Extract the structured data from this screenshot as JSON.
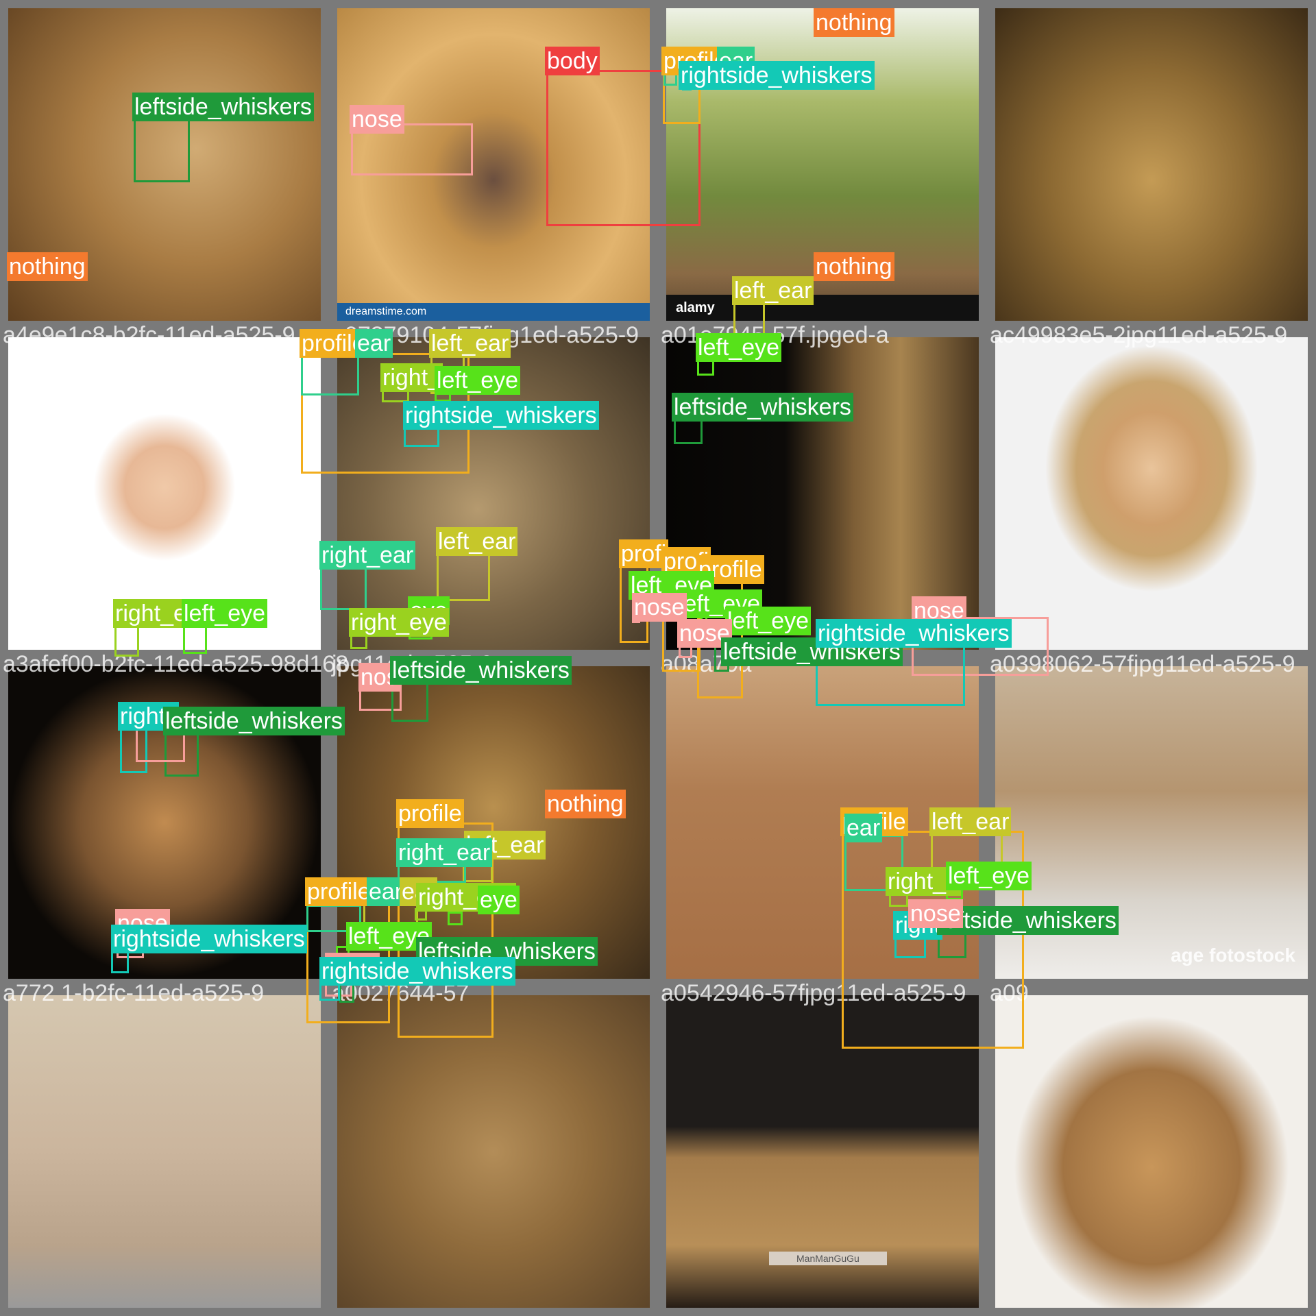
{
  "colors": {
    "nothing": "#f47a2e",
    "body": "#ef3f3f",
    "profile": "#f2ae1d",
    "nose": "#f79e9a",
    "left_ear": "#c6c72a",
    "right_ear": "#2fcf8c",
    "left_eye": "#57e21a",
    "right_eye": "#9ad21f",
    "leftside_whiskers": "#1f9a3a",
    "rightside_whiskers": "#13c9b6",
    "tile_border": "#7a7a7a"
  },
  "tiles": [
    {
      "filename": "",
      "photo": "lion-face-held-by-hand",
      "labels": [
        {
          "cls": "leftside_whiskers",
          "text": "leftside_whiskers"
        },
        {
          "cls": "nothing",
          "text": "nothing"
        }
      ]
    },
    {
      "filename": "",
      "photo": "lion-nose-closeup",
      "watermark": "dreamstime.com",
      "labels": [
        {
          "cls": "nose",
          "text": "nose"
        }
      ]
    },
    {
      "filename": "",
      "photo": "lioness-on-rock",
      "watermark": "alamy",
      "labels": [
        {
          "cls": "body",
          "text": "body"
        },
        {
          "cls": "profile",
          "text": "profile"
        },
        {
          "cls": "right_ear",
          "text": "ear"
        },
        {
          "cls": "rightside_whiskers",
          "text": "rightside_whiskers"
        }
      ]
    },
    {
      "filename": "",
      "photo": "lion-painting",
      "labels": [
        {
          "cls": "nothing",
          "text": "nothing"
        },
        {
          "cls": "nothing",
          "text": "nothing"
        }
      ]
    },
    {
      "filename": "a4e9e1c8-b2fc-11ed-a525-9",
      "photo": "man-with-lion-ears",
      "labels": []
    },
    {
      "filename": "a07379104-57fjpg1ed-a525-9",
      "photo": "lioness-snarling",
      "labels": [
        {
          "cls": "profile",
          "text": "profile"
        },
        {
          "cls": "right_ear",
          "text": "ear"
        },
        {
          "cls": "left_ear",
          "text": "left_ear"
        },
        {
          "cls": "right_eye",
          "text": "right_"
        },
        {
          "cls": "left_eye",
          "text": "left_eye"
        },
        {
          "cls": "rightside_whiskers",
          "text": "rightside_whiskers"
        }
      ]
    },
    {
      "filename": "a01e7945-57f.jpged-a",
      "photo": "male-lion-dark",
      "labels": [
        {
          "cls": "left_ear",
          "text": "left_ear"
        },
        {
          "cls": "left_eye",
          "text": "left_eye"
        },
        {
          "cls": "leftside_whiskers",
          "text": "leftside_whiskers"
        }
      ]
    },
    {
      "filename": "ac49983e5-2jpg11ed-a525-9",
      "photo": "woman-lion-mask",
      "labels": []
    },
    {
      "filename": "a3afef00-b2fc-11ed-a525-98d168",
      "photo": "lion-face-black-bg",
      "labels": [
        {
          "cls": "right_eye",
          "text": "right_e"
        },
        {
          "cls": "left_eye",
          "text": "left_eye"
        },
        {
          "cls": "rightside_whiskers",
          "text": "rights"
        },
        {
          "cls": "leftside_whiskers",
          "text": "leftside_whiskers"
        }
      ]
    },
    {
      "filename": "jpg11ed-a525-9",
      "photo": "lion-mane-closeup",
      "labels": [
        {
          "cls": "right_ear",
          "text": "right_ear"
        },
        {
          "cls": "left_ear",
          "text": "left_ear"
        },
        {
          "cls": "left_eye",
          "text": "eye"
        },
        {
          "cls": "right_eye",
          "text": "right_eye"
        },
        {
          "cls": "nose",
          "text": "nos"
        },
        {
          "cls": "leftside_whiskers",
          "text": "leftside_whiskers"
        }
      ]
    },
    {
      "filename": "a08a79a",
      "photo": "three-lions-walking",
      "labels": [
        {
          "cls": "profile",
          "text": "profi"
        },
        {
          "cls": "profile",
          "text": "profi"
        },
        {
          "cls": "profile",
          "text": "profile"
        },
        {
          "cls": "left_eye",
          "text": "left_eye"
        },
        {
          "cls": "left_eye",
          "text": "left_eye"
        },
        {
          "cls": "left_eye",
          "text": "left_eye"
        },
        {
          "cls": "nose",
          "text": "nose"
        },
        {
          "cls": "nose",
          "text": "nose"
        },
        {
          "cls": "leftside_whiskers",
          "text": "leftside_whiskers"
        }
      ]
    },
    {
      "filename": "a0398062-57fjpg11ed-a525-9",
      "photo": "lion-muzzle-closeup",
      "watermark": "age fotostock",
      "labels": [
        {
          "cls": "nose",
          "text": "nose"
        },
        {
          "cls": "rightside_whiskers",
          "text": "rightside_whiskers"
        }
      ]
    },
    {
      "filename": "a772 1-b2fc-11ed-a525-9",
      "photo": "lion-skin-on-sack",
      "labels": [
        {
          "cls": "nose",
          "text": "nose"
        },
        {
          "cls": "rightside_whiskers",
          "text": "rightside_whiskers"
        }
      ]
    },
    {
      "filename": "a0027644-57",
      "photo": "lion-pair",
      "labels": [
        {
          "cls": "profile",
          "text": "profile"
        },
        {
          "cls": "left_ear",
          "text": "left_ear"
        },
        {
          "cls": "right_ear",
          "text": "right_ear"
        },
        {
          "cls": "profile",
          "text": "profile"
        },
        {
          "cls": "right_ear",
          "text": "ear"
        },
        {
          "cls": "left_ear",
          "text": "ear"
        },
        {
          "cls": "right_eye",
          "text": "right_eye"
        },
        {
          "cls": "left_eye",
          "text": "eye"
        },
        {
          "cls": "left_eye",
          "text": "left_eye"
        },
        {
          "cls": "nose",
          "text": "nose"
        },
        {
          "cls": "leftside_whiskers",
          "text": "leftside_whiskers"
        },
        {
          "cls": "rightside_whiskers",
          "text": "rightside_whiskers"
        }
      ]
    },
    {
      "filename": "a0542946-57fjpg11ed-a525-9",
      "photo": "lion-head-back",
      "watermark": "ManManGuGu",
      "labels": [
        {
          "cls": "nothing",
          "text": "nothing"
        }
      ]
    },
    {
      "filename": "a09",
      "photo": "lion-head-cutout",
      "labels": [
        {
          "cls": "profile",
          "text": "profile"
        },
        {
          "cls": "right_ear",
          "text": "ear"
        },
        {
          "cls": "left_ear",
          "text": "left_ear"
        },
        {
          "cls": "right_eye",
          "text": "right_e"
        },
        {
          "cls": "left_eye",
          "text": "left_eye"
        },
        {
          "cls": "rightside_whiskers",
          "text": "right"
        },
        {
          "cls": "leftside_whiskers",
          "text": "leftside_whiskers"
        },
        {
          "cls": "nose",
          "text": "nose"
        }
      ]
    }
  ]
}
